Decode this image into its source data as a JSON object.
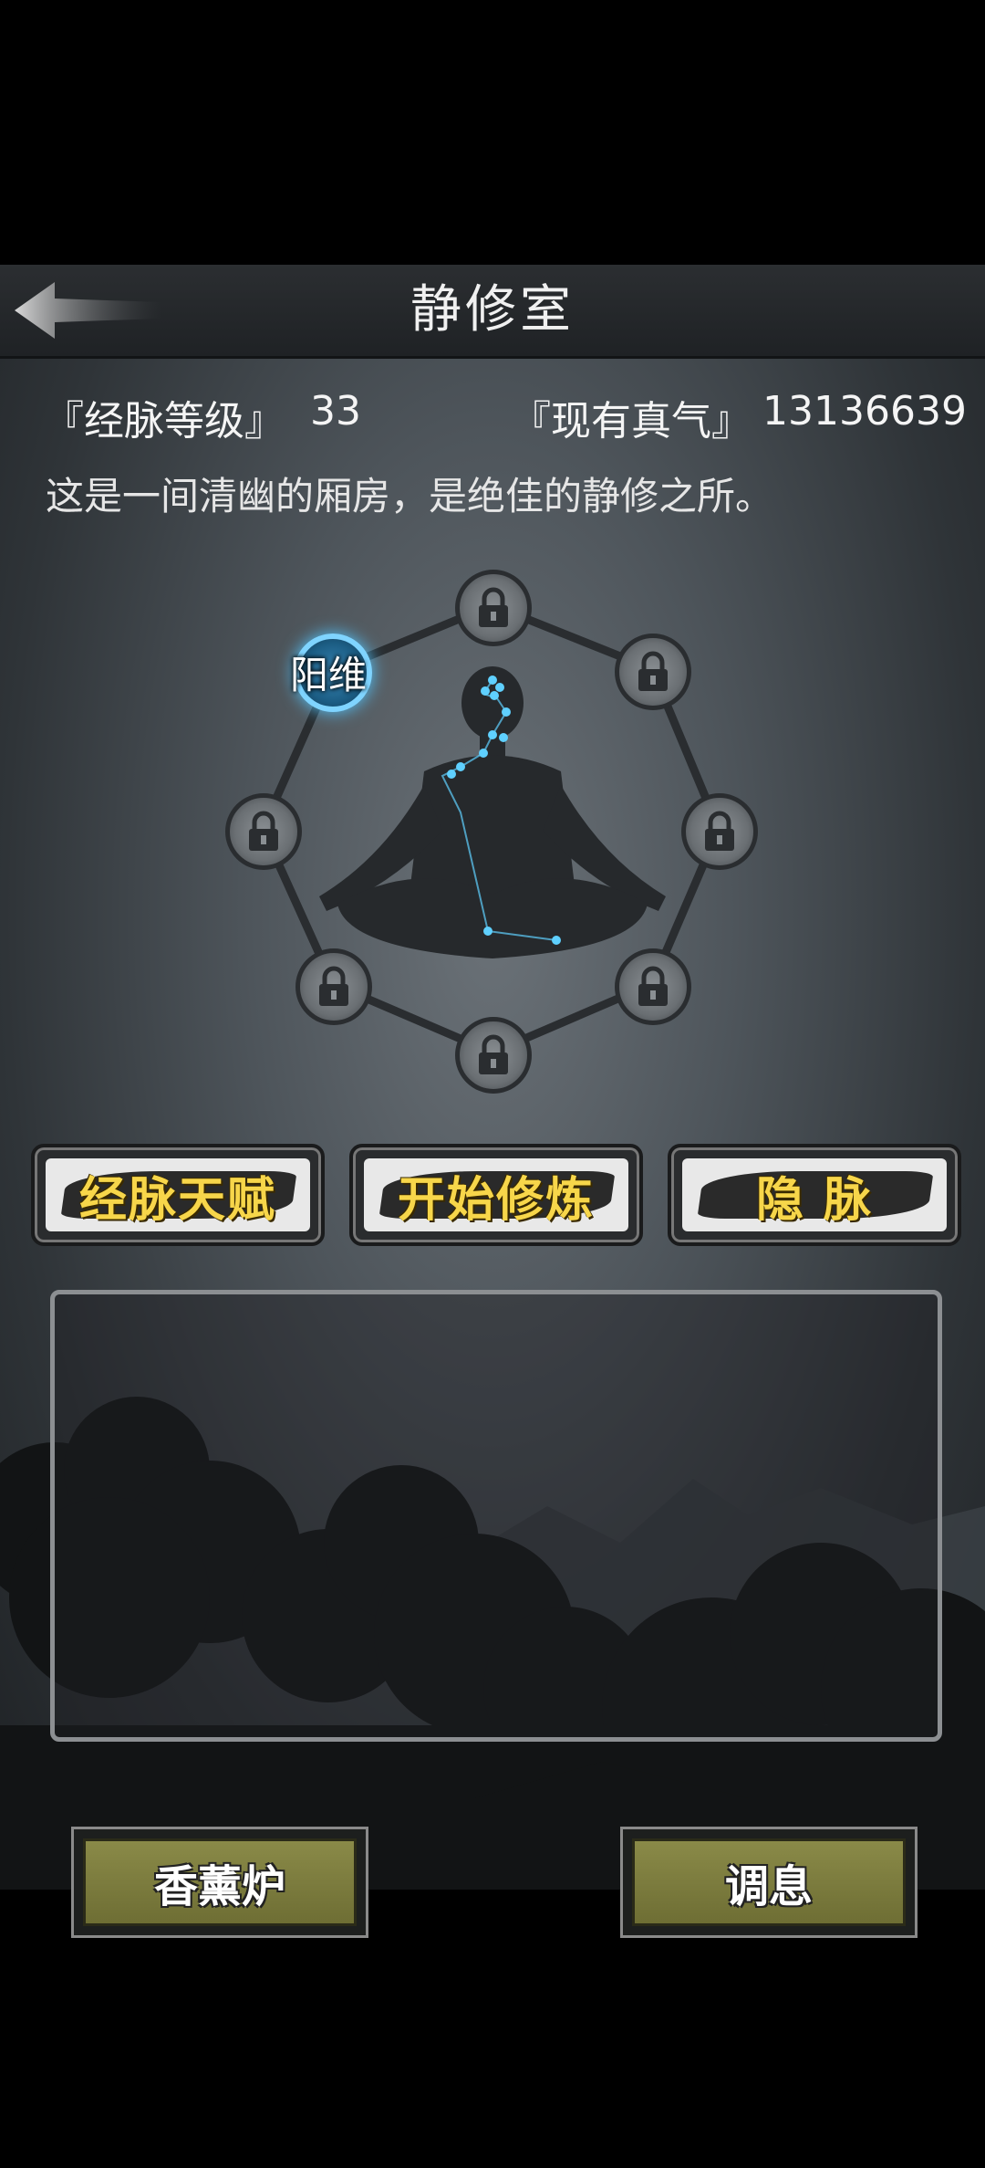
{
  "header": {
    "title": "静修室",
    "back_icon": "back-arrow-icon"
  },
  "stats": {
    "level_label": "『经脉等级』",
    "level_value": "33",
    "qi_label": "『现有真气』",
    "qi_value": "13136639"
  },
  "description": "这是一间清幽的厢房，是绝佳的静修之所。",
  "meridian": {
    "active_node_label": "阳维",
    "nodes": [
      {
        "name": "top",
        "state": "locked"
      },
      {
        "name": "upper-right",
        "state": "locked"
      },
      {
        "name": "right",
        "state": "locked"
      },
      {
        "name": "lower-right",
        "state": "locked"
      },
      {
        "name": "bottom",
        "state": "locked"
      },
      {
        "name": "lower-left",
        "state": "locked"
      },
      {
        "name": "left",
        "state": "locked"
      },
      {
        "name": "upper-left",
        "state": "active"
      }
    ],
    "accent_color": "#5fd0ff"
  },
  "actions": {
    "talent": "经脉天赋",
    "start": "开始修炼",
    "hidden": "隐 脉"
  },
  "bottom": {
    "incense": "香薰炉",
    "rest": "调息"
  }
}
